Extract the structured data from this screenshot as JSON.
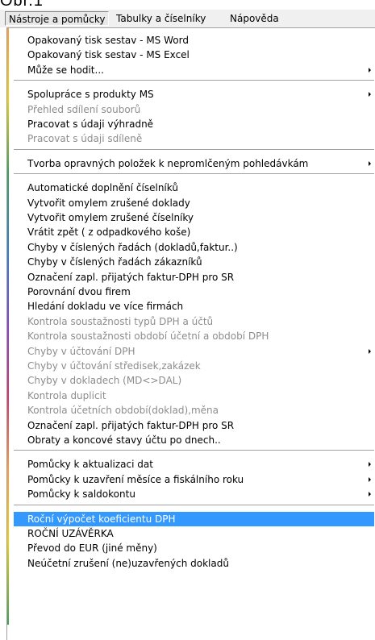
{
  "window_title_fragment": "Obr.1",
  "menubar": {
    "items": [
      {
        "label": "Nástroje a pomůcky",
        "active": true
      },
      {
        "label": "Tabulky a číselníky",
        "active": false
      },
      {
        "label": "Nápověda",
        "active": false
      }
    ]
  },
  "menu": {
    "groups": [
      [
        {
          "label": "Opakovaný tisk sestav - MS Word",
          "enabled": true,
          "submenu": false
        },
        {
          "label": "Opakovaný tisk sestav - MS Excel",
          "enabled": true,
          "submenu": false
        },
        {
          "label": "Může se hodit...",
          "enabled": true,
          "submenu": true
        }
      ],
      [
        {
          "label": "Spolupráce s produkty MS",
          "enabled": true,
          "submenu": true
        },
        {
          "label": "Přehled sdílení souborů",
          "enabled": false,
          "submenu": false
        },
        {
          "label": "Pracovat s údaji výhradně",
          "enabled": true,
          "submenu": false
        },
        {
          "label": "Pracovat s údaji sdíleně",
          "enabled": false,
          "submenu": false
        }
      ],
      [
        {
          "label": "Tvorba opravných položek k nepromlčeným pohledávkám",
          "enabled": true,
          "submenu": true
        }
      ],
      [
        {
          "label": "Automatické doplnění číselníků",
          "enabled": true,
          "submenu": false
        },
        {
          "label": "Vytvořit omylem zrušené doklady",
          "enabled": true,
          "submenu": false
        },
        {
          "label": "Vytvořit omylem zrušené číselníky",
          "enabled": true,
          "submenu": false
        },
        {
          "label": "Vrátit zpět ( z  odpadkového koše)",
          "enabled": true,
          "submenu": false
        },
        {
          "label": "Chyby v číslených řadách (dokladů,faktur..)",
          "enabled": true,
          "submenu": false
        },
        {
          "label": "Chyby v číslených řadách zákazníků",
          "enabled": true,
          "submenu": false
        },
        {
          "label": "Označení zapl. přijatých faktur-DPH pro SR",
          "enabled": true,
          "submenu": false
        },
        {
          "label": "Porovnání dvou firem",
          "enabled": true,
          "submenu": false
        },
        {
          "label": "Hledání dokladu ve více firmách",
          "enabled": true,
          "submenu": false
        },
        {
          "label": "Kontrola soustažnosti typů DPH a účtů",
          "enabled": false,
          "submenu": false
        },
        {
          "label": "Kontrola soustažnosti období účetní a období DPH",
          "enabled": false,
          "submenu": false
        },
        {
          "label": "Chyby v účtování DPH",
          "enabled": false,
          "submenu": true
        },
        {
          "label": "Chyby v účtování středisek,zakázek",
          "enabled": false,
          "submenu": false
        },
        {
          "label": "Chyby v dokladech (MD<>DAL)",
          "enabled": false,
          "submenu": false
        },
        {
          "label": "Kontrola duplicit",
          "enabled": false,
          "submenu": false
        },
        {
          "label": "Kontrola účetních období(doklad),měna",
          "enabled": false,
          "submenu": false
        },
        {
          "label": "Označení zapl. přijatých faktur-DPH pro SR",
          "enabled": true,
          "submenu": false
        },
        {
          "label": "Obraty a koncové stavy účtu po dnech..",
          "enabled": true,
          "submenu": false
        }
      ],
      [
        {
          "label": "Pomůcky k aktualizaci dat",
          "enabled": true,
          "submenu": true
        },
        {
          "label": "Pomůcky k uzavření měsíce a fiskálního roku",
          "enabled": true,
          "submenu": true
        },
        {
          "label": "Pomůcky k saldokontu",
          "enabled": true,
          "submenu": true
        }
      ],
      [
        {
          "label": "Roční výpočet koeficientu DPH",
          "enabled": true,
          "submenu": false,
          "selected": true
        },
        {
          "label": "ROČNÍ  UZÁVĚRKA",
          "enabled": true,
          "submenu": false
        },
        {
          "label": "Převod  do EUR (jiné měny)",
          "enabled": true,
          "submenu": false
        },
        {
          "label": "Neúčetní zrušení  (ne)uzavřených dokladů",
          "enabled": true,
          "submenu": false
        }
      ]
    ]
  },
  "colors": {
    "selection": "#3399ff",
    "disabled_text": "#8c8c8c",
    "menubar_bg": "#f0f0f0"
  }
}
